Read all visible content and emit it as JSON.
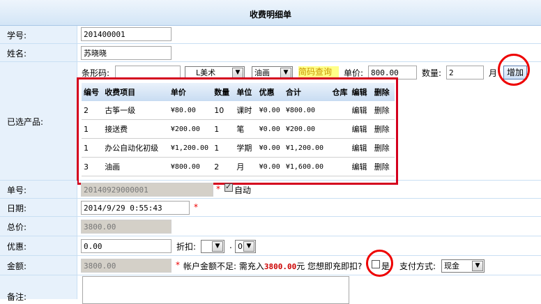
{
  "page": {
    "title": "收费明细单"
  },
  "student": {
    "id_label": "学号:",
    "id_value": "201400001",
    "name_label": "姓名:",
    "name_value": "苏晓晓"
  },
  "selected": {
    "label": "已选产品:",
    "barcode_label": "条形码:",
    "barcode_value": "",
    "category_value": "L美术",
    "product_value": "油画",
    "lookup_link": "简码查询",
    "price_label": "单价:",
    "price_value": "800.00",
    "qty_label": "数量:",
    "qty_value": "2",
    "unit": "月",
    "add_button": "增加",
    "columns": [
      "编号",
      "收费项目",
      "单价",
      "数量",
      "单位",
      "优惠",
      "合计",
      "仓库",
      "编辑",
      "删除"
    ],
    "rows": [
      {
        "no": "2",
        "item": "古筝一级",
        "price": "¥80.00",
        "qty": "10",
        "unit": "课时",
        "discount": "¥0.00",
        "total": "¥800.00",
        "warehouse": "",
        "edit": "编辑",
        "delete": "删除"
      },
      {
        "no": "1",
        "item": "接送费",
        "price": "¥200.00",
        "qty": "1",
        "unit": "笔",
        "discount": "¥0.00",
        "total": "¥200.00",
        "warehouse": "",
        "edit": "编辑",
        "delete": "删除"
      },
      {
        "no": "1",
        "item": "办公自动化初级",
        "price": "¥1,200.00",
        "qty": "1",
        "unit": "学期",
        "discount": "¥0.00",
        "total": "¥1,200.00",
        "warehouse": "",
        "edit": "编辑",
        "delete": "删除"
      },
      {
        "no": "3",
        "item": "油画",
        "price": "¥800.00",
        "qty": "2",
        "unit": "月",
        "discount": "¥0.00",
        "total": "¥1,600.00",
        "warehouse": "",
        "edit": "编辑",
        "delete": "删除"
      }
    ]
  },
  "order": {
    "no_label": "单号:",
    "no_value": "20140929000001",
    "required_mark": "*",
    "auto_label": "自动",
    "date_label": "日期:",
    "date_value": "2014/9/29 0:55:43",
    "total_label": "总价:",
    "total_value": "3800.00",
    "discount_label": "优惠:",
    "discount_value": "0.00",
    "rebate_label": "折扣:",
    "rebate_dot": ".",
    "rebate_decimal": "0",
    "amount_label": "金额:",
    "amount_value": "3800.00",
    "insufficient_pre": "帐户金额不足: 需充入",
    "insufficient_amount": "3800.00",
    "insufficient_post": "元 您想即充即扣?",
    "yes_label": "是",
    "pay_label": "支付方式:",
    "pay_value": "现金",
    "memo_label": "备注:"
  },
  "colors": {
    "accent_red": "#e00000",
    "label_bg": "#e7f1fb",
    "header_bg": "#d3e5f6"
  }
}
